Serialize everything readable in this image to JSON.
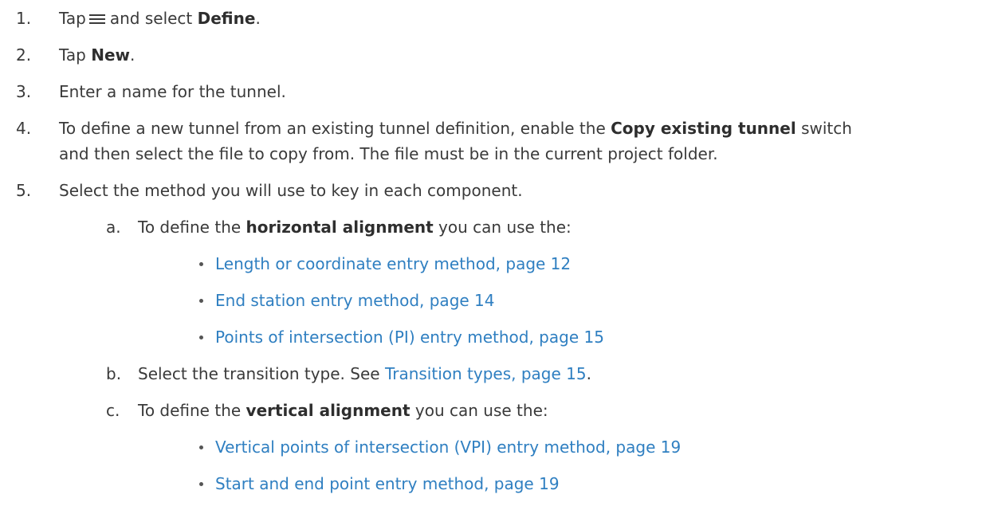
{
  "steps": [
    {
      "num": "1.",
      "pre": "Tap",
      "mid": "and select",
      "bold": "Define",
      "post": "."
    },
    {
      "num": "2.",
      "pre": "Tap",
      "bold": "New",
      "post": "."
    },
    {
      "num": "3.",
      "text": "Enter a name for the tunnel."
    },
    {
      "num": "4.",
      "pre": "To define a new tunnel from an existing tunnel definition, enable the",
      "bold": "Copy existing tunnel",
      "post": "switch",
      "line2": "and then select the file to copy from. The file must be in the current project folder."
    },
    {
      "num": "5.",
      "text": "Select the method you will use to key in each component."
    }
  ],
  "substeps": {
    "a": {
      "letter": "a.",
      "pre": "To define the",
      "bold": "horizontal alignment",
      "post": "you can use the:",
      "links": [
        "Length or coordinate entry method, page 12",
        "End station entry method, page 14",
        "Points of intersection (PI) entry method, page 15"
      ]
    },
    "b": {
      "letter": "b.",
      "pre": "Select the transition type. See",
      "link": "Transition types, page 15",
      "post": "."
    },
    "c": {
      "letter": "c.",
      "pre": "To define the",
      "bold": "vertical alignment",
      "post": "you can use the:",
      "links": [
        "Vertical points of intersection (VPI) entry method, page 19",
        "Start and end point entry method, page 19"
      ]
    }
  },
  "icons": {
    "menu": "hamburger-menu-icon",
    "bullet": "bullet-icon"
  },
  "colors": {
    "text": "#3a3a3a",
    "link": "#2f7fc1"
  }
}
